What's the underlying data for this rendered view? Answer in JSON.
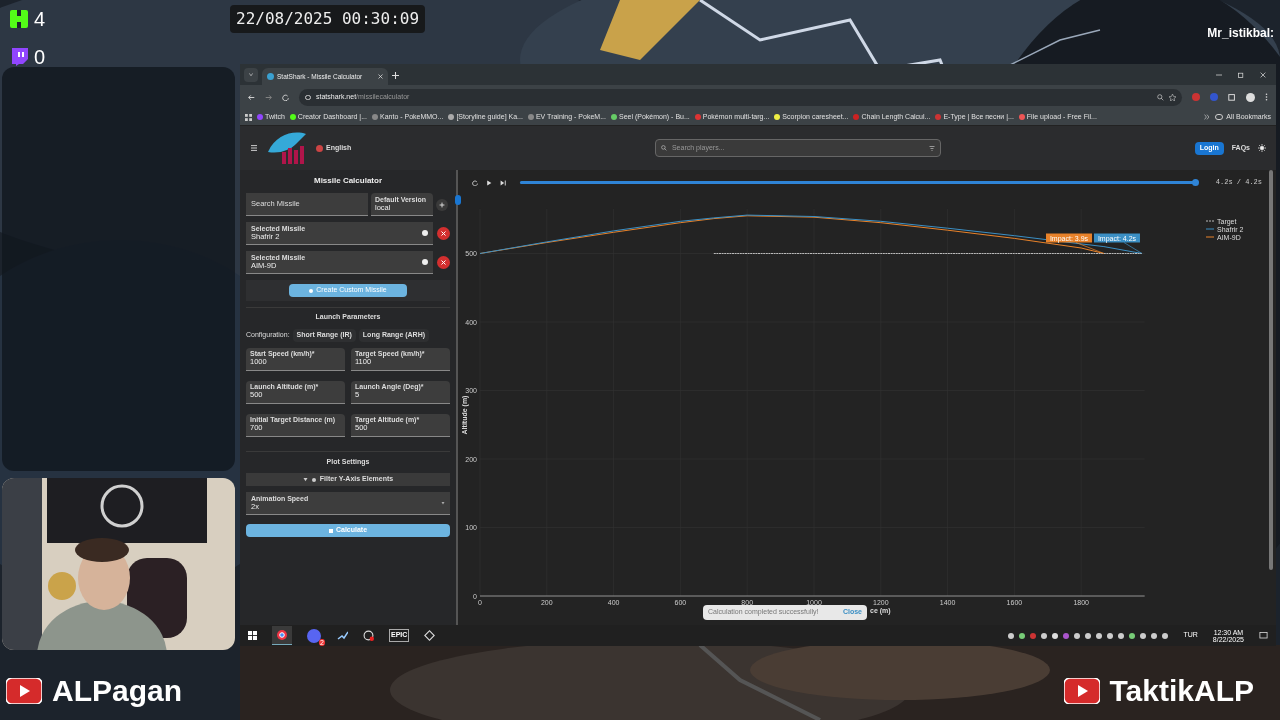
{
  "overlay": {
    "kick_count": "4",
    "twitch_count": "0",
    "timestamp": "22/08/2025 00:30:09",
    "chat_name": "Mr_istikbal:",
    "channel_left": "ALPagan",
    "channel_right": "TaktikALP"
  },
  "browser": {
    "tab_title": "StatShark - Missile Calculator",
    "url_host": "statshark.net",
    "url_path": "/missilecalculator",
    "bookmarks": [
      "Twitch",
      "Creator Dashboard |...",
      "Kanto - PokeMMO...",
      "[Storyline guide] Ka...",
      "EV Training - PokeM...",
      "Seel (Pokémon) - Bu...",
      "Pokémon multi-targ...",
      "Scorpion caresheet...",
      "Chain Length Calcul...",
      "E-Type | Все песни |...",
      "File upload - Free Fil..."
    ],
    "all_bookmarks": "All Bookmarks"
  },
  "header": {
    "language": "English",
    "search_placeholder": "Search players...",
    "login": "Login",
    "faqs": "FAQs"
  },
  "panel": {
    "title": "Missile Calculator",
    "search_label": "Search Missile",
    "version_label": "Default Version",
    "version_value": "local",
    "selected": [
      {
        "label": "Selected Missile",
        "value": "Shafrir 2"
      },
      {
        "label": "Selected Missile",
        "value": "AIM-9D"
      }
    ],
    "create_button": "Create Custom Missile",
    "launch_title": "Launch Parameters",
    "config_label": "Configuration:",
    "configs": [
      {
        "label": "Short Range (IR)",
        "selected": false
      },
      {
        "label": "Long Range (ARH)",
        "selected": false
      }
    ],
    "fields": [
      {
        "label": "Start Speed (km/h)*",
        "value": "1000"
      },
      {
        "label": "Target Speed (km/h)*",
        "value": "1100"
      },
      {
        "label": "Launch Altitude (m)*",
        "value": "500"
      },
      {
        "label": "Launch Angle (Deg)*",
        "value": "5"
      },
      {
        "label": "Initial Target Distance (m)",
        "value": "700"
      },
      {
        "label": "Target Altitude (m)*",
        "value": "500"
      }
    ],
    "plot_title": "Plot Settings",
    "filter_button": "Filter Y-Axis Elements",
    "speed_label": "Animation Speed",
    "speed_value": "2x",
    "calculate": "Calculate"
  },
  "player": {
    "level": 1,
    "time": "4.2s / 4.2s"
  },
  "chart": {
    "chart_data": {
      "type": "line",
      "grid": true,
      "legend": true,
      "ylabel": "Altitude (m)",
      "xlabel": "ce (m)",
      "x": [
        0,
        200,
        400,
        600,
        700,
        800,
        1000,
        1200,
        1400,
        1600,
        1800,
        1868,
        1982
      ],
      "xlim": [
        0,
        1990
      ],
      "ylim": [
        0,
        565
      ],
      "xticks": [
        0,
        200,
        400,
        600,
        800,
        1000,
        1200,
        1400,
        1600,
        1800
      ],
      "yticks": [
        0,
        100,
        200,
        300,
        400,
        500
      ],
      "series": [
        {
          "name": "Target",
          "color": "#bbbbbb",
          "line_style": "dashed",
          "values": [
            null,
            null,
            null,
            null,
            500,
            500,
            500,
            500,
            500,
            500,
            500,
            500,
            500
          ]
        },
        {
          "name": "Shafrir 2",
          "color": "#3b8fc4",
          "values": [
            500,
            517,
            533,
            547,
            552,
            556,
            554,
            547,
            537,
            526,
            514,
            510,
            500
          ]
        },
        {
          "name": "AIM-9D",
          "color": "#e8822a",
          "values": [
            500,
            516,
            531,
            545,
            551,
            555,
            553,
            545,
            534,
            522,
            508,
            500,
            null
          ]
        }
      ],
      "annotations": [
        {
          "text": "Impact: 3.9s",
          "x": 1868,
          "y": 500
        },
        {
          "text": "Impact: 4.2s",
          "x": 1982,
          "y": 500
        }
      ]
    }
  },
  "toast": {
    "message": "Calculation completed successfully!",
    "close": "Close"
  },
  "taskbar": {
    "badge": "2",
    "epic": "EPIC",
    "lang": "TUR",
    "time": "12:30 AM",
    "date": "8/22/2025"
  }
}
